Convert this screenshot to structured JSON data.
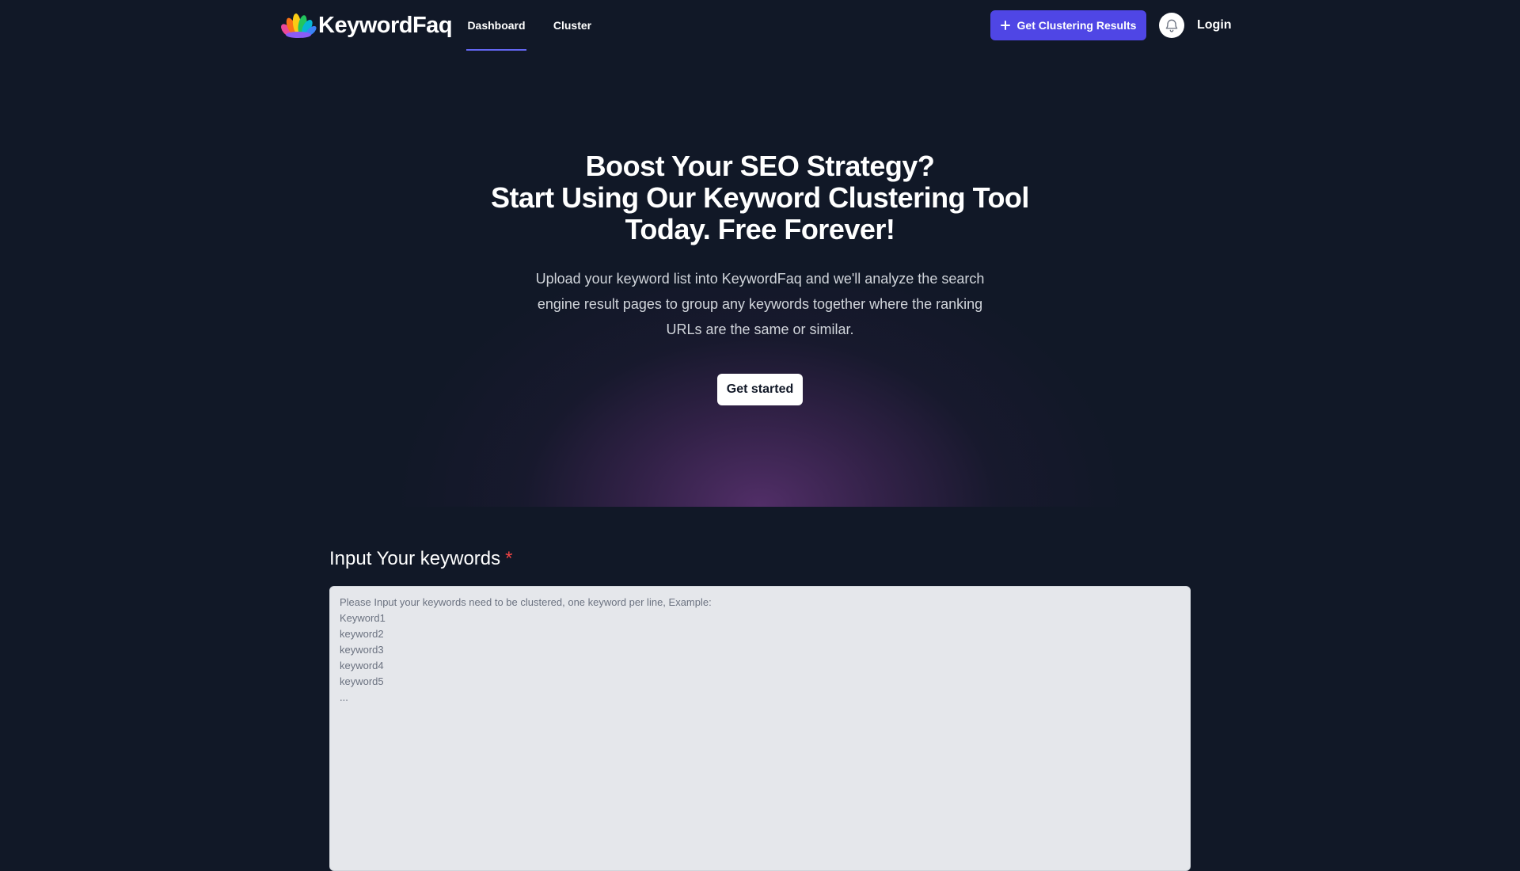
{
  "nav": {
    "logo_text": "KeywordFaq",
    "tabs": [
      {
        "label": "Dashboard",
        "active": true
      },
      {
        "label": "Cluster",
        "active": false
      }
    ],
    "cta_label": "Get Clustering Results",
    "login_label": "Login",
    "icons": {
      "cta": "plus-icon",
      "notifications": "bell-icon"
    }
  },
  "hero": {
    "title_lines": [
      "Boost Your SEO Strategy?",
      "Start Using Our Keyword Clustering Tool",
      "Today. Free Forever!"
    ],
    "subtitle": "Upload your keyword list into KeywordFaq and we'll analyze the search engine result pages to group any keywords together where the ranking URLs are the same or similar.",
    "button_label": "Get started"
  },
  "form": {
    "label": "Input Your keywords",
    "required_mark": "*",
    "value": "",
    "placeholder": "Please Input your keywords need to be clustered, one keyword per line, Example:\nKeyword1\nkeyword2\nkeyword3\nkeyword4\nkeyword5\n..."
  },
  "colors": {
    "background": "#111827",
    "accent": "#4f46e5",
    "tab_underline": "#6366f1",
    "required": "#ef4444",
    "glow": "#86409c",
    "textarea_bg": "#e5e7eb"
  }
}
